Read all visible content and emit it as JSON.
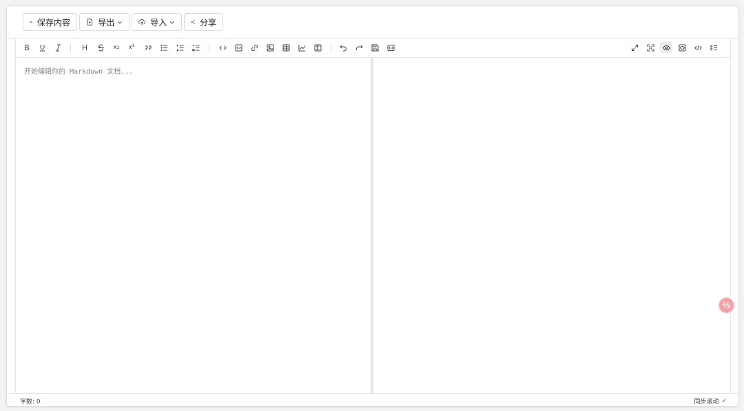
{
  "topbar": {
    "save_label": "保存内容",
    "export_label": "导出",
    "import_label": "导入",
    "share_label": "分享"
  },
  "toolbar": {
    "bold": "B",
    "heading": "H",
    "subscript": "x₂",
    "superscript": "x²"
  },
  "editor": {
    "placeholder": "开始编辑你的 Markdown 文档..."
  },
  "status": {
    "word_count": "字数: 0",
    "sync_scroll": "同步滚动",
    "sync_check": "✓"
  },
  "float_badge": "⅔",
  "colors": {
    "accent_badge": "#f2a3a8",
    "border": "#e6e6e8"
  }
}
